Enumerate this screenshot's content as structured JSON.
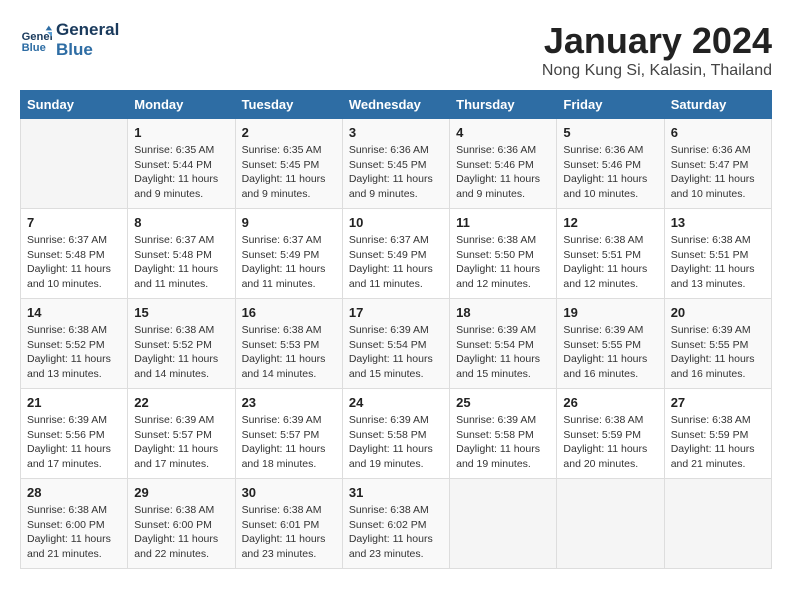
{
  "header": {
    "logo_line1": "General",
    "logo_line2": "Blue",
    "month": "January 2024",
    "location": "Nong Kung Si, Kalasin, Thailand"
  },
  "weekdays": [
    "Sunday",
    "Monday",
    "Tuesday",
    "Wednesday",
    "Thursday",
    "Friday",
    "Saturday"
  ],
  "weeks": [
    [
      {
        "day": null
      },
      {
        "day": 1,
        "sunrise": "6:35 AM",
        "sunset": "5:44 PM",
        "daylight": "11 hours and 9 minutes."
      },
      {
        "day": 2,
        "sunrise": "6:35 AM",
        "sunset": "5:45 PM",
        "daylight": "11 hours and 9 minutes."
      },
      {
        "day": 3,
        "sunrise": "6:36 AM",
        "sunset": "5:45 PM",
        "daylight": "11 hours and 9 minutes."
      },
      {
        "day": 4,
        "sunrise": "6:36 AM",
        "sunset": "5:46 PM",
        "daylight": "11 hours and 9 minutes."
      },
      {
        "day": 5,
        "sunrise": "6:36 AM",
        "sunset": "5:46 PM",
        "daylight": "11 hours and 10 minutes."
      },
      {
        "day": 6,
        "sunrise": "6:36 AM",
        "sunset": "5:47 PM",
        "daylight": "11 hours and 10 minutes."
      }
    ],
    [
      {
        "day": 7,
        "sunrise": "6:37 AM",
        "sunset": "5:48 PM",
        "daylight": "11 hours and 10 minutes."
      },
      {
        "day": 8,
        "sunrise": "6:37 AM",
        "sunset": "5:48 PM",
        "daylight": "11 hours and 11 minutes."
      },
      {
        "day": 9,
        "sunrise": "6:37 AM",
        "sunset": "5:49 PM",
        "daylight": "11 hours and 11 minutes."
      },
      {
        "day": 10,
        "sunrise": "6:37 AM",
        "sunset": "5:49 PM",
        "daylight": "11 hours and 11 minutes."
      },
      {
        "day": 11,
        "sunrise": "6:38 AM",
        "sunset": "5:50 PM",
        "daylight": "11 hours and 12 minutes."
      },
      {
        "day": 12,
        "sunrise": "6:38 AM",
        "sunset": "5:51 PM",
        "daylight": "11 hours and 12 minutes."
      },
      {
        "day": 13,
        "sunrise": "6:38 AM",
        "sunset": "5:51 PM",
        "daylight": "11 hours and 13 minutes."
      }
    ],
    [
      {
        "day": 14,
        "sunrise": "6:38 AM",
        "sunset": "5:52 PM",
        "daylight": "11 hours and 13 minutes."
      },
      {
        "day": 15,
        "sunrise": "6:38 AM",
        "sunset": "5:52 PM",
        "daylight": "11 hours and 14 minutes."
      },
      {
        "day": 16,
        "sunrise": "6:38 AM",
        "sunset": "5:53 PM",
        "daylight": "11 hours and 14 minutes."
      },
      {
        "day": 17,
        "sunrise": "6:39 AM",
        "sunset": "5:54 PM",
        "daylight": "11 hours and 15 minutes."
      },
      {
        "day": 18,
        "sunrise": "6:39 AM",
        "sunset": "5:54 PM",
        "daylight": "11 hours and 15 minutes."
      },
      {
        "day": 19,
        "sunrise": "6:39 AM",
        "sunset": "5:55 PM",
        "daylight": "11 hours and 16 minutes."
      },
      {
        "day": 20,
        "sunrise": "6:39 AM",
        "sunset": "5:55 PM",
        "daylight": "11 hours and 16 minutes."
      }
    ],
    [
      {
        "day": 21,
        "sunrise": "6:39 AM",
        "sunset": "5:56 PM",
        "daylight": "11 hours and 17 minutes."
      },
      {
        "day": 22,
        "sunrise": "6:39 AM",
        "sunset": "5:57 PM",
        "daylight": "11 hours and 17 minutes."
      },
      {
        "day": 23,
        "sunrise": "6:39 AM",
        "sunset": "5:57 PM",
        "daylight": "11 hours and 18 minutes."
      },
      {
        "day": 24,
        "sunrise": "6:39 AM",
        "sunset": "5:58 PM",
        "daylight": "11 hours and 19 minutes."
      },
      {
        "day": 25,
        "sunrise": "6:39 AM",
        "sunset": "5:58 PM",
        "daylight": "11 hours and 19 minutes."
      },
      {
        "day": 26,
        "sunrise": "6:38 AM",
        "sunset": "5:59 PM",
        "daylight": "11 hours and 20 minutes."
      },
      {
        "day": 27,
        "sunrise": "6:38 AM",
        "sunset": "5:59 PM",
        "daylight": "11 hours and 21 minutes."
      }
    ],
    [
      {
        "day": 28,
        "sunrise": "6:38 AM",
        "sunset": "6:00 PM",
        "daylight": "11 hours and 21 minutes."
      },
      {
        "day": 29,
        "sunrise": "6:38 AM",
        "sunset": "6:00 PM",
        "daylight": "11 hours and 22 minutes."
      },
      {
        "day": 30,
        "sunrise": "6:38 AM",
        "sunset": "6:01 PM",
        "daylight": "11 hours and 23 minutes."
      },
      {
        "day": 31,
        "sunrise": "6:38 AM",
        "sunset": "6:02 PM",
        "daylight": "11 hours and 23 minutes."
      },
      {
        "day": null
      },
      {
        "day": null
      },
      {
        "day": null
      }
    ]
  ]
}
